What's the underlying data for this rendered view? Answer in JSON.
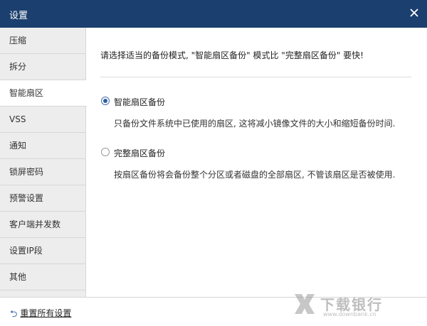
{
  "window": {
    "title": "设置"
  },
  "sidebar": {
    "items": [
      {
        "label": "压缩",
        "active": false
      },
      {
        "label": "拆分",
        "active": false
      },
      {
        "label": "智能扇区",
        "active": true
      },
      {
        "label": "VSS",
        "active": false
      },
      {
        "label": "通知",
        "active": false
      },
      {
        "label": "锁屏密码",
        "active": false
      },
      {
        "label": "预警设置",
        "active": false
      },
      {
        "label": "客户端并发数",
        "active": false
      },
      {
        "label": "设置IP段",
        "active": false
      },
      {
        "label": "其他",
        "active": false
      }
    ]
  },
  "main": {
    "description": "请选择适当的备份模式, \"智能扇区备份\" 模式比 \"完整扇区备份\" 要快!",
    "options": [
      {
        "label": "智能扇区备份",
        "checked": true,
        "description": "只备份文件系统中已使用的扇区, 这将减小镜像文件的大小和缩短备份时间."
      },
      {
        "label": "完整扇区备份",
        "checked": false,
        "description": "按扇区备份将会备份整个分区或者磁盘的全部扇区, 不管该扇区是否被使用."
      }
    ]
  },
  "footer": {
    "reset_label": "重置所有设置",
    "reset_icon": "undo-arrow-icon"
  },
  "watermark": {
    "text": "下载银行",
    "url": "www.downbank.cn"
  },
  "colors": {
    "titlebar": "#1b3f6e",
    "sidebar_bg": "#ededed",
    "radio_accent": "#2f5f9f"
  }
}
